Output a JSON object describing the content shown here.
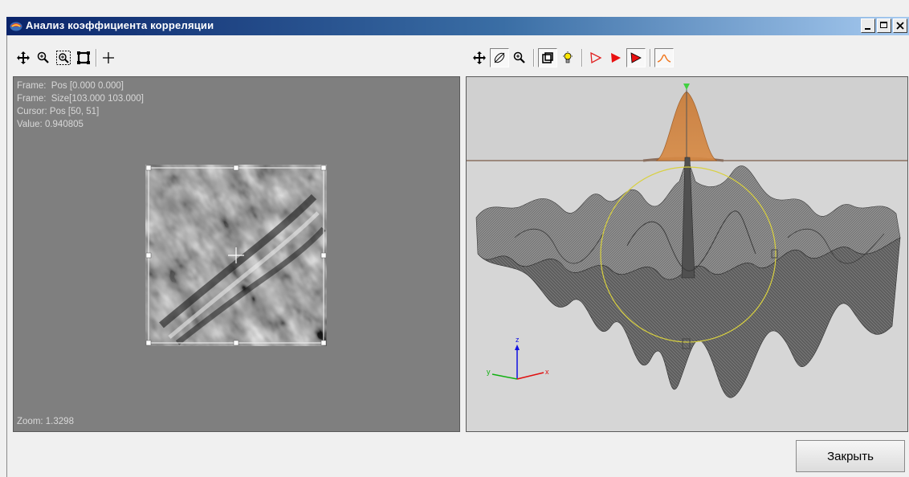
{
  "window": {
    "title": "Анализ коэффициента корреляции",
    "accent_color": "#0a246a"
  },
  "left_panel": {
    "frame_pos": "Frame:  Pos [0.000 0.000]",
    "frame_size": "Frame:  Size[103.000 103.000]",
    "cursor_pos": "Cursor: Pos [50, 51]",
    "value": "Value: 0.940805",
    "zoom": "Zoom: 1.3298"
  },
  "right_panel": {
    "axis_z": "z",
    "axis_y": "y",
    "axis_x": "x"
  },
  "toolbar_left": {
    "icons": [
      "pan-icon",
      "zoom-icon",
      "zoom-region-icon",
      "fit-frame-icon",
      "crosshair-icon"
    ]
  },
  "toolbar_right": {
    "icons": [
      "pan-icon",
      "rotate-icon",
      "zoom-icon",
      "frame-icon",
      "light-icon",
      "cone-outline-icon",
      "cone-solid-icon",
      "cone-pressed-icon",
      "profile-curve-icon"
    ]
  },
  "buttons": {
    "close_label": "Закрыть"
  }
}
